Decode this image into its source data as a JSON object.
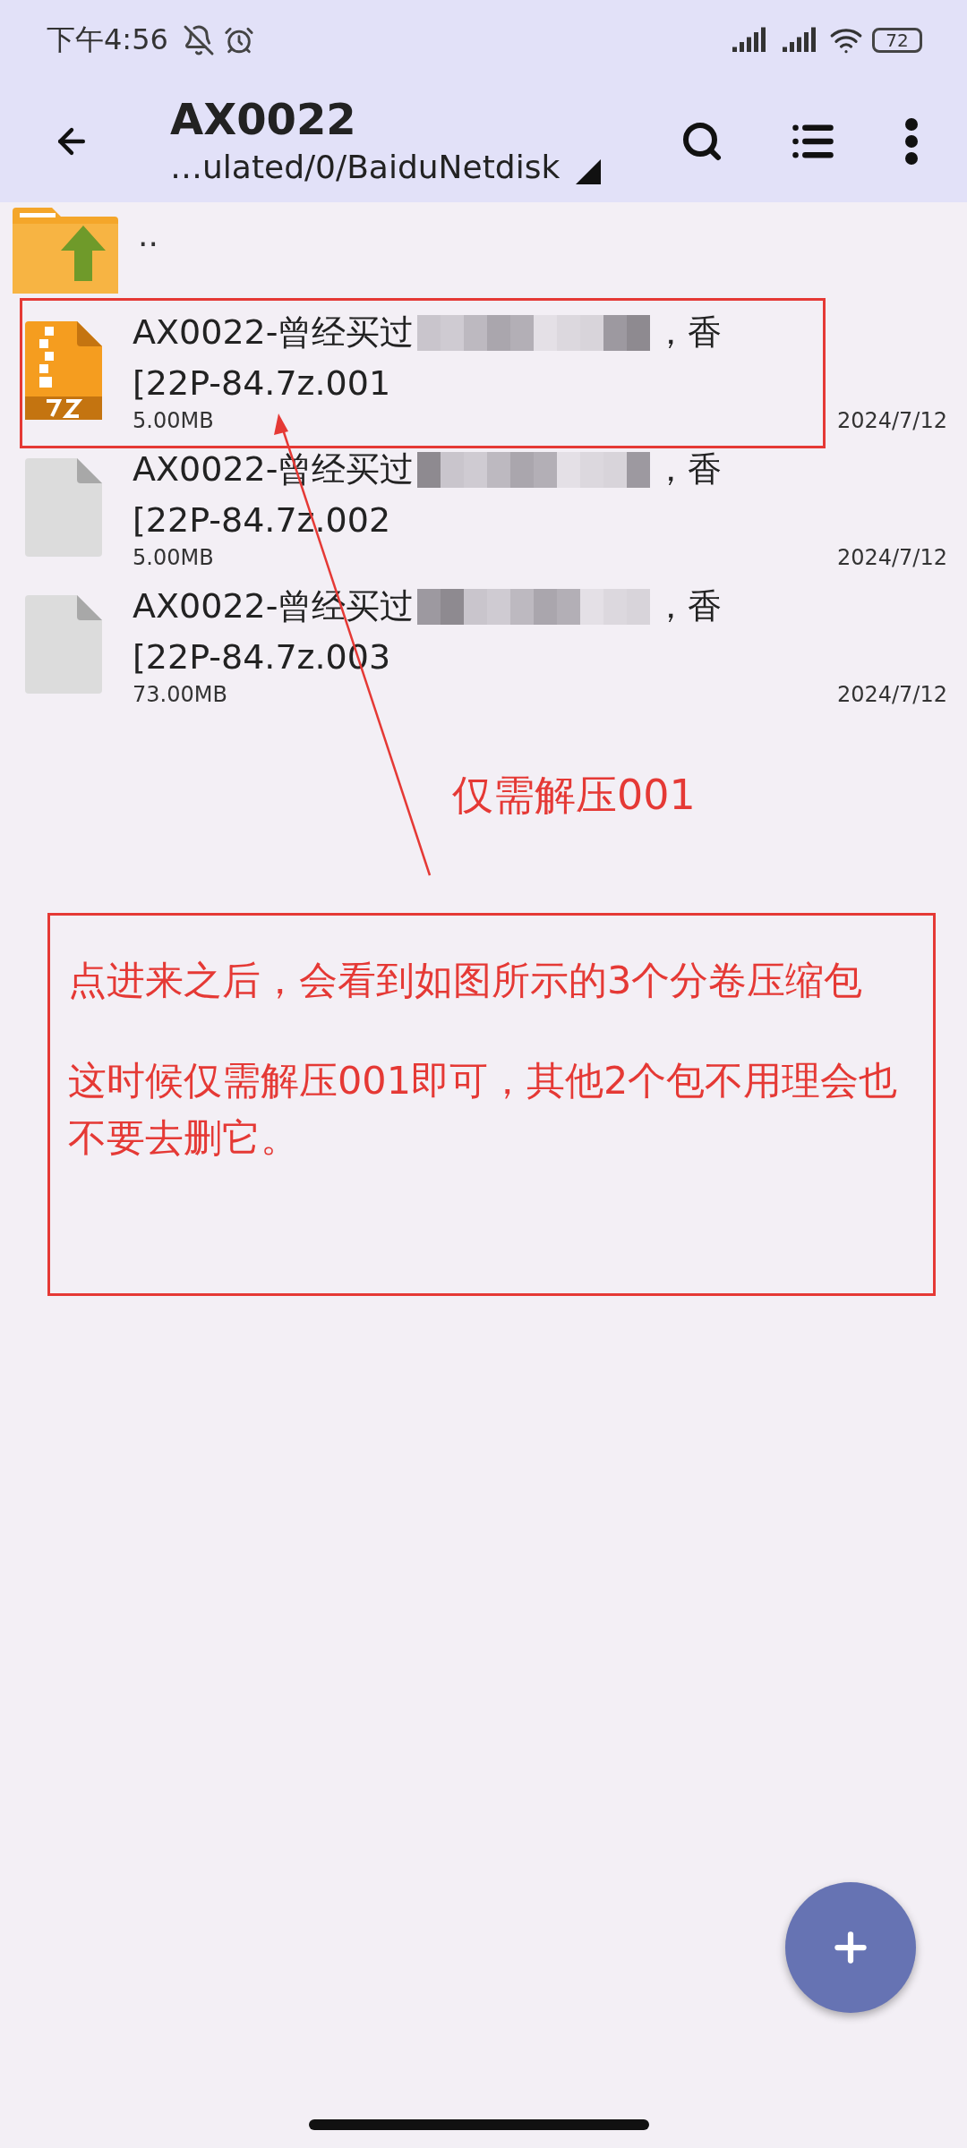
{
  "status_bar": {
    "time": "下午4:56",
    "battery": "72"
  },
  "toolbar": {
    "title": "AX0022",
    "path": "…ulated/0/BaiduNetdisk"
  },
  "parent_entry": {
    "label": ".."
  },
  "files": [
    {
      "kind": "archive",
      "name_start": "AX0022-曾经买过",
      "name_end": "，香",
      "name_line2": "[22P-84.7z.001",
      "size": "5.00MB",
      "date": "2024/7/12",
      "highlighted": true
    },
    {
      "kind": "file",
      "name_start": "AX0022-曾经买过",
      "name_end": "，香",
      "name_line2": "[22P-84.7z.002",
      "size": "5.00MB",
      "date": "2024/7/12",
      "highlighted": false
    },
    {
      "kind": "file",
      "name_start": "AX0022-曾经买过",
      "name_end": "，香",
      "name_line2": "[22P-84.7z.003",
      "size": "73.00MB",
      "date": "2024/7/12",
      "highlighted": false
    }
  ],
  "annotation": {
    "arrow_label": "仅需解压001",
    "note_lines": [
      "点进来之后，会看到如图所示的3个分卷压缩包",
      "这时候仅需解压001即可，其他2个包不用理会也不要去删它。"
    ]
  }
}
